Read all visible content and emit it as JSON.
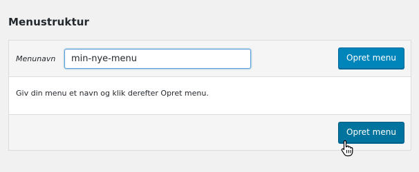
{
  "section": {
    "title": "Menustruktur"
  },
  "menu_form": {
    "name_label": "Menunavn",
    "name_value": "min-nye-menu",
    "create_button_top": "Opret menu",
    "description": "Giv din menu et navn og klik derefter Opret menu.",
    "create_button_bottom": "Opret menu"
  },
  "colors": {
    "primary_button": "#0085ba",
    "primary_button_hover": "#00749f",
    "input_focus": "#5b9dd9"
  },
  "cursor": {
    "icon": "hand-pointer-icon"
  }
}
